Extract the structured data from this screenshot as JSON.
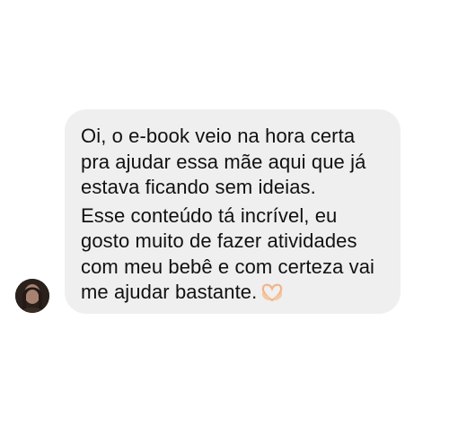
{
  "message": {
    "paragraphs": [
      {
        "lines": [
          "Oi, o e-book veio na hora certa",
          "pra ajudar essa mãe aqui que já",
          "estava ficando sem ideias."
        ]
      },
      {
        "lines": [
          "Esse conteúdo tá incrível, eu",
          "gosto muito de fazer atividades",
          "com meu bebê e com certeza vai",
          "me ajudar bastante."
        ]
      }
    ],
    "emoji": "heart-hands-icon"
  },
  "sender": {
    "avatar_icon": "profile-photo"
  },
  "colors": {
    "bubble": "#efefef",
    "text": "#111111",
    "background": "#ffffff"
  }
}
